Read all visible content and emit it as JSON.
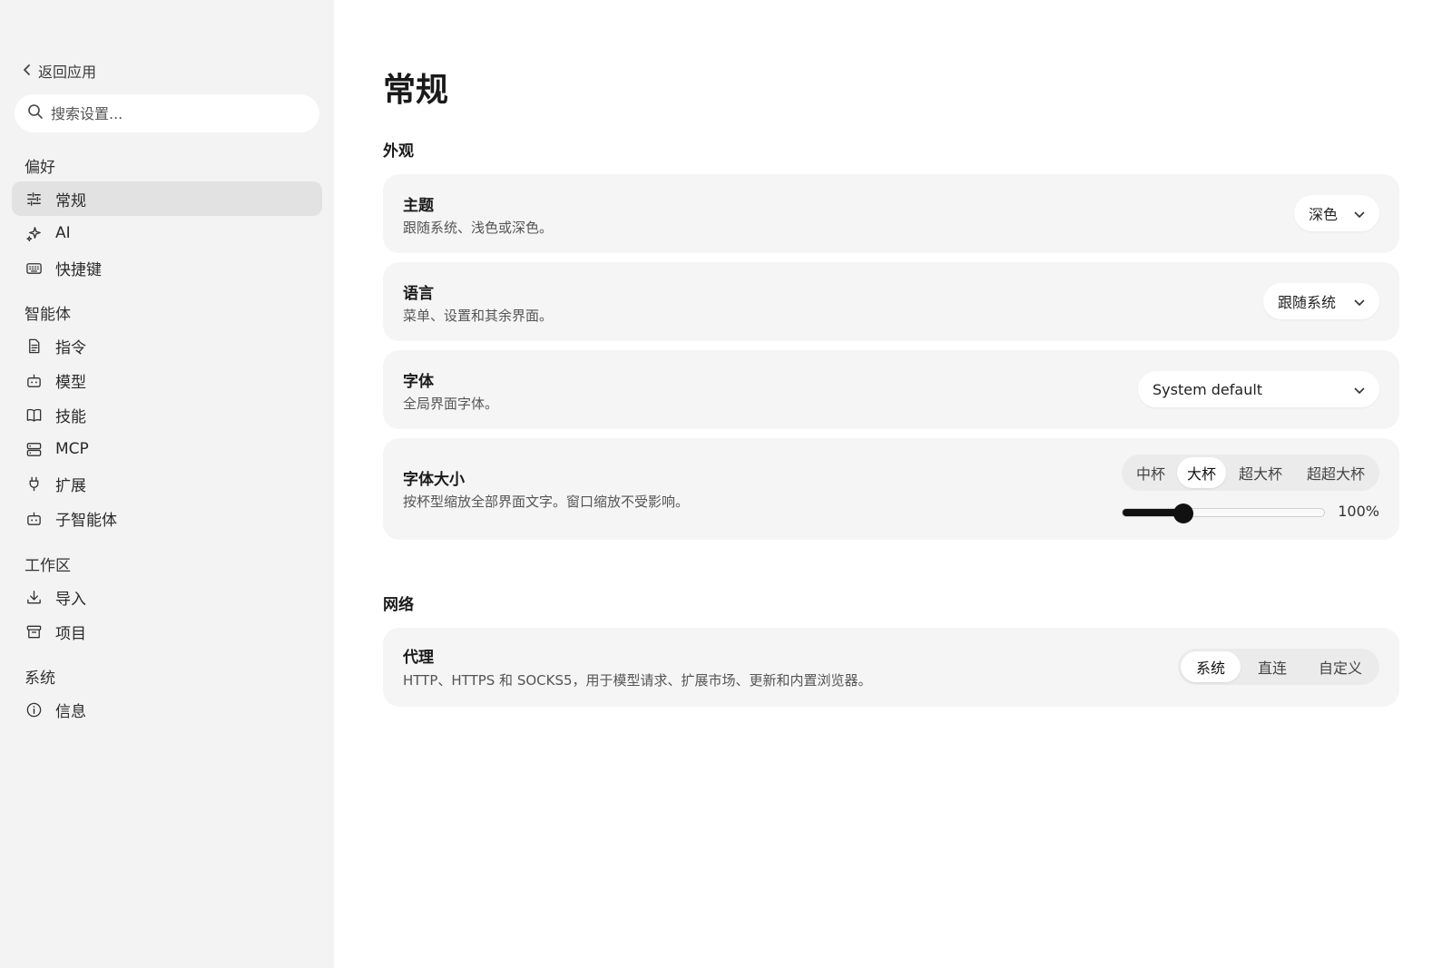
{
  "sidebar": {
    "back_label": "返回应用",
    "search_placeholder": "搜索设置...",
    "groups": [
      {
        "title": "偏好",
        "items": [
          {
            "label": "常规",
            "icon": "sliders-icon",
            "active": true
          },
          {
            "label": "AI",
            "icon": "sparkles-icon"
          },
          {
            "label": "快捷键",
            "icon": "keyboard-icon"
          }
        ]
      },
      {
        "title": "智能体",
        "items": [
          {
            "label": "指令",
            "icon": "document-icon"
          },
          {
            "label": "模型",
            "icon": "bot-icon"
          },
          {
            "label": "技能",
            "icon": "book-icon"
          },
          {
            "label": "MCP",
            "icon": "server-icon"
          },
          {
            "label": "扩展",
            "icon": "plug-icon"
          },
          {
            "label": "子智能体",
            "icon": "bot-icon"
          }
        ]
      },
      {
        "title": "工作区",
        "items": [
          {
            "label": "导入",
            "icon": "download-icon"
          },
          {
            "label": "项目",
            "icon": "archive-icon"
          }
        ]
      },
      {
        "title": "系统",
        "items": [
          {
            "label": "信息",
            "icon": "info-icon"
          }
        ]
      }
    ]
  },
  "main": {
    "title": "常规",
    "appearance": {
      "section_title": "外观",
      "theme": {
        "label": "主题",
        "desc": "跟随系统、浅色或深色。",
        "value": "深色"
      },
      "language": {
        "label": "语言",
        "desc": "菜单、设置和其余界面。",
        "value": "跟随系统"
      },
      "font": {
        "label": "字体",
        "desc": "全局界面字体。",
        "value": "System default"
      },
      "font_size": {
        "label": "字体大小",
        "desc": "按杯型缩放全部界面文字。窗口缩放不受影响。",
        "options": [
          "中杯",
          "大杯",
          "超大杯",
          "超超大杯"
        ],
        "selected": "大杯",
        "slider_fraction": 0.3,
        "slider_value": "100%"
      }
    },
    "network": {
      "section_title": "网络",
      "proxy": {
        "label": "代理",
        "desc": "HTTP、HTTPS 和 SOCKS5，用于模型请求、扩展市场、更新和内置浏览器。",
        "options": [
          "系统",
          "直连",
          "自定义"
        ],
        "selected": "系统"
      }
    }
  },
  "colors": {
    "sidebar_bg": "#f3f3f3",
    "card_bg": "#f5f5f5",
    "active_nav": "#e2e2e2",
    "accent": "#111111"
  }
}
